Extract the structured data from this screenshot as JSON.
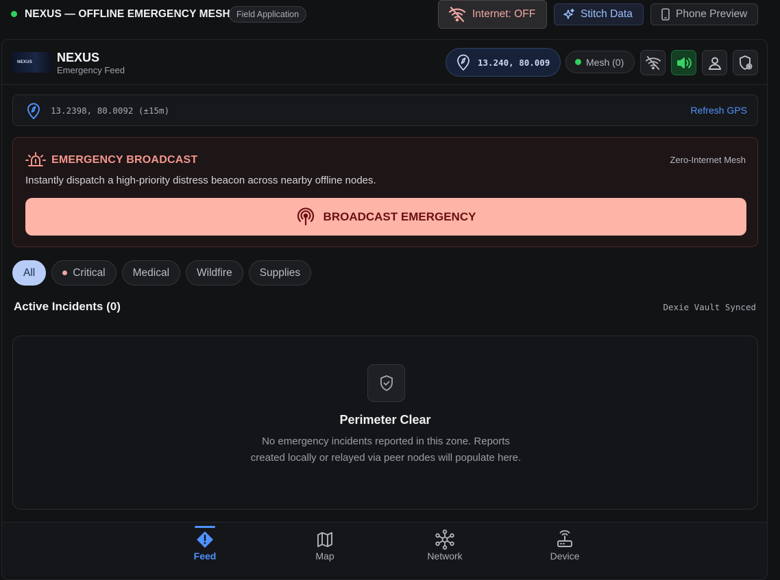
{
  "topbar": {
    "app_title": "NEXUS — OFFLINE EMERGENCY MESH",
    "badge": "Field Application",
    "internet_label": "Internet: OFF",
    "stitch_label": "Stitch Data",
    "phone_label": "Phone Preview"
  },
  "header": {
    "logo_text": "NEXUS",
    "title": "NEXUS",
    "subtitle": "Emergency Feed",
    "coords": "13.240, 80.009",
    "mesh_label": "Mesh (0)"
  },
  "gps": {
    "text": "13.2398, 80.0092 (±15m)",
    "refresh_label": "Refresh GPS"
  },
  "emergency": {
    "title": "EMERGENCY BROADCAST",
    "tag": "Zero-Internet Mesh",
    "description": "Instantly dispatch a high-priority distress beacon across nearby offline nodes.",
    "button_label": "BROADCAST EMERGENCY"
  },
  "filters": [
    "All",
    "Critical",
    "Medical",
    "Wildfire",
    "Supplies"
  ],
  "incidents": {
    "title": "Active Incidents (0)",
    "sync_label": "Dexie Vault Synced"
  },
  "empty_state": {
    "title": "Perimeter Clear",
    "description": "No emergency incidents reported in this zone. Reports created locally or relayed via peer nodes will populate here."
  },
  "nav": {
    "feed": "Feed",
    "map": "Map",
    "network": "Network",
    "device": "Device"
  },
  "colors": {
    "accent": "#4f93ff",
    "status_online": "#2fd15d",
    "emergency": "#ffb4a8",
    "emergency_text": "#f4968b"
  }
}
